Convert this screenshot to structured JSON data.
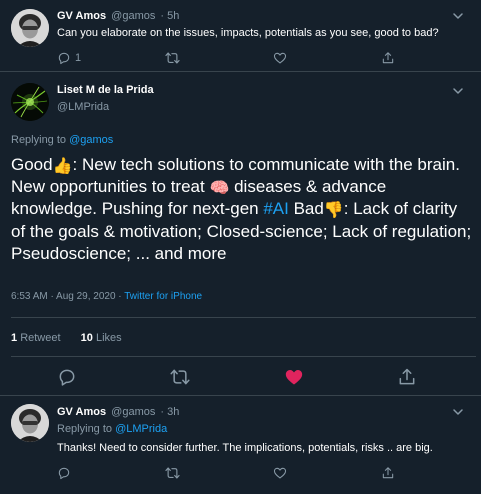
{
  "parent_tweet": {
    "display_name": "GV Amos",
    "handle": "@gamos",
    "time": "· 5h",
    "text": "Can you elaborate on the issues, impacts, potentials as you see, good to bad?",
    "reply_count": "1",
    "retweet_count": "",
    "like_count": ""
  },
  "main_tweet": {
    "display_name": "Liset M de la Prida",
    "handle": "@LMPrida",
    "replying_label": "Replying to",
    "replying_handle": "@gamos",
    "text": {
      "good": "Good",
      "after_good": ": New tech solutions to communicate with the brain. New opportunities to treat ",
      "after_brain": " diseases & advance knowledge. Pushing for next-gen ",
      "hashtag": "#AI",
      "bad": " Bad",
      "after_bad": ": Lack of clarity of the goals & motivation; Closed-science; Lack of regulation; Pseudoscience; ... and more"
    },
    "emoji": {
      "thumbs_up": "👍",
      "brain": "🧠",
      "thumbs_down": "👎"
    },
    "timestamp": "6:53 AM · Aug 29, 2020",
    "separator": " · ",
    "source": "Twitter for iPhone",
    "retweets_number": "1",
    "retweets_label": "Retweet",
    "likes_number": "10",
    "likes_label": "Likes",
    "liked": true
  },
  "reply_tweet": {
    "display_name": "GV Amos",
    "handle": "@gamos",
    "time": "· 3h",
    "replying_label": "Replying to",
    "replying_handle": "@LMPrida",
    "text": "Thanks! Need to consider further. The implications, potentials, risks .. are big."
  },
  "colors": {
    "background": "#15202b",
    "border": "#38444d",
    "muted_text": "#8899a6",
    "link": "#1da1f2",
    "like_active": "#e0245e"
  },
  "icons": [
    "reply-icon",
    "retweet-icon",
    "like-icon",
    "share-icon",
    "chevron-down-icon"
  ]
}
